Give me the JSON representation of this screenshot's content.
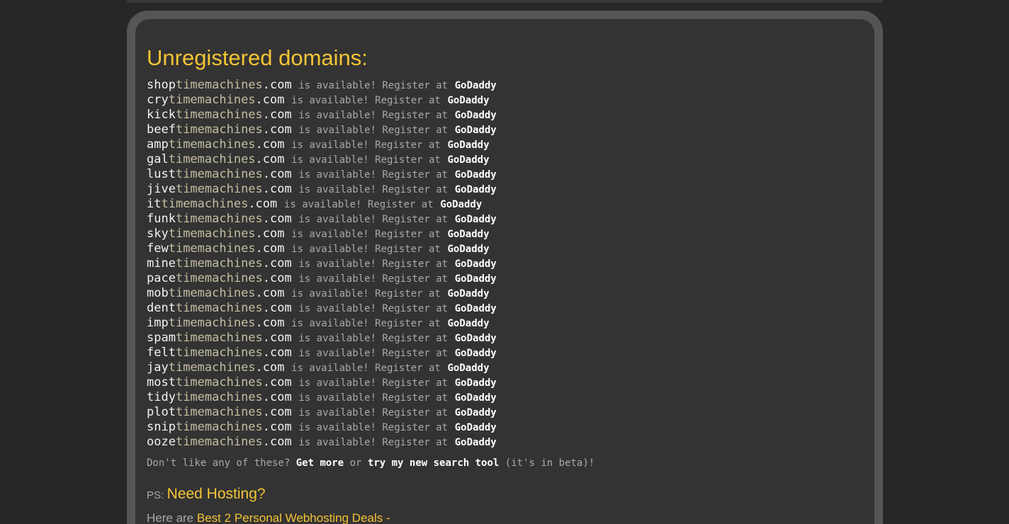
{
  "heading": "Unregistered domains:",
  "base_name": "timemachines",
  "tld": ".com",
  "availability_text": "is available! Register at",
  "registrar": "GoDaddy",
  "domains": [
    {
      "prefix": "shop"
    },
    {
      "prefix": "cry"
    },
    {
      "prefix": "kick"
    },
    {
      "prefix": "beef"
    },
    {
      "prefix": "amp"
    },
    {
      "prefix": "gal"
    },
    {
      "prefix": "lust"
    },
    {
      "prefix": "jive"
    },
    {
      "prefix": "it"
    },
    {
      "prefix": "funk"
    },
    {
      "prefix": "sky"
    },
    {
      "prefix": "few"
    },
    {
      "prefix": "mine"
    },
    {
      "prefix": "pace"
    },
    {
      "prefix": "mob"
    },
    {
      "prefix": "dent"
    },
    {
      "prefix": "imp"
    },
    {
      "prefix": "spam"
    },
    {
      "prefix": "felt"
    },
    {
      "prefix": "jay"
    },
    {
      "prefix": "most"
    },
    {
      "prefix": "tidy"
    },
    {
      "prefix": "plot"
    },
    {
      "prefix": "snip"
    },
    {
      "prefix": "ooze"
    }
  ],
  "more": {
    "intro": "Don't like any of these?",
    "get_more": "Get more",
    "or": "or",
    "search_tool": "try my new search tool",
    "beta_note": "(it's in beta)!"
  },
  "hosting": {
    "ps_label": "PS:",
    "title": "Need Hosting?",
    "deals_intro": "Here are",
    "deals_link": "Best 2 Personal Webhosting Deals -"
  },
  "colors": {
    "page_background": "#262727",
    "panel_background": "#333333",
    "frame": "#555555",
    "accent_yellow": "#f5c435",
    "base_name_tan": "#c5bea2",
    "muted_text": "#a9a9a9"
  }
}
